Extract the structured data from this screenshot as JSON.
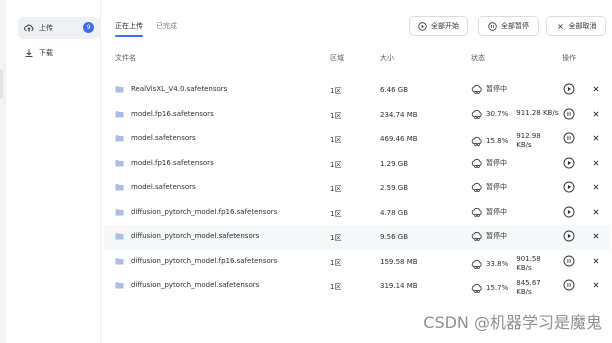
{
  "sidebar": {
    "upload_label": "上传",
    "upload_count": "9",
    "download_label": "下载"
  },
  "tabs": {
    "uploading": "正在上传",
    "completed": "已完成"
  },
  "toolbar": {
    "start_all": "全部开始",
    "pause_all": "全部暂停",
    "cancel_all": "全部取消"
  },
  "columns": {
    "file_name": "文件名",
    "zone": "区域",
    "size": "大小",
    "status": "状态",
    "action": "操作"
  },
  "rows": [
    {
      "file": "RealVisXL_V4.0.safetensors",
      "zone": "1区",
      "size": "6.46 GB",
      "state": "paused",
      "status_text": "暂停中",
      "percent": "",
      "speed": "",
      "highlight": false
    },
    {
      "file": "model.fp16.safetensors",
      "zone": "1区",
      "size": "234.74 MB",
      "state": "uploading",
      "status_text": "",
      "percent": "30.7%",
      "speed": "911.28 KB/s",
      "highlight": false
    },
    {
      "file": "model.safetensors",
      "zone": "1区",
      "size": "469.46 MB",
      "state": "uploading",
      "status_text": "",
      "percent": "15.8%",
      "speed": "912.98 KB/s",
      "highlight": false
    },
    {
      "file": "model.fp16.safetensors",
      "zone": "1区",
      "size": "1.29 GB",
      "state": "paused",
      "status_text": "暂停中",
      "percent": "",
      "speed": "",
      "highlight": false
    },
    {
      "file": "model.safetensors",
      "zone": "1区",
      "size": "2.59 GB",
      "state": "paused",
      "status_text": "暂停中",
      "percent": "",
      "speed": "",
      "highlight": false
    },
    {
      "file": "diffusion_pytorch_model.fp16.safetensors",
      "zone": "1区",
      "size": "4.78 GB",
      "state": "paused",
      "status_text": "暂停中",
      "percent": "",
      "speed": "",
      "highlight": false
    },
    {
      "file": "diffusion_pytorch_model.safetensors",
      "zone": "1区",
      "size": "9.56 GB",
      "state": "paused",
      "status_text": "暂停中",
      "percent": "",
      "speed": "",
      "highlight": true
    },
    {
      "file": "diffusion_pytorch_model.fp16.safetensors",
      "zone": "1区",
      "size": "159.58 MB",
      "state": "uploading",
      "status_text": "",
      "percent": "33.8%",
      "speed": "901.58 KB/s",
      "highlight": false
    },
    {
      "file": "diffusion_pytorch_model.safetensors",
      "zone": "1区",
      "size": "319.14 MB",
      "state": "uploading",
      "status_text": "",
      "percent": "15.7%",
      "speed": "845.67 KB/s",
      "highlight": false
    }
  ],
  "watermark": "CSDN @机器学习是魔鬼",
  "colors": {
    "accent": "#3b6cf6",
    "folder": "#a9bde6"
  }
}
